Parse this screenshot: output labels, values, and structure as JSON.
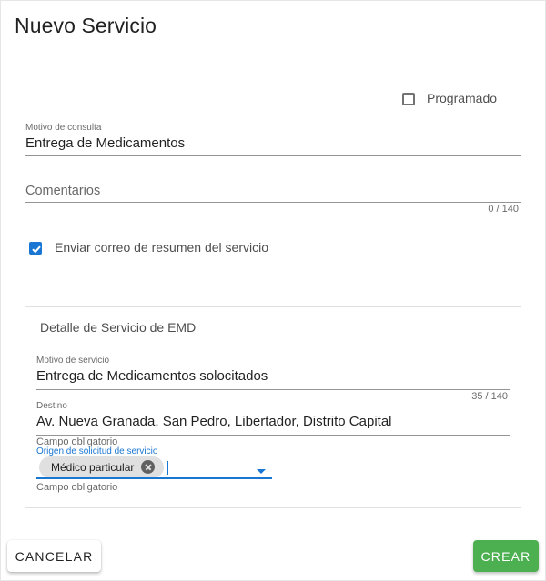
{
  "dialog": {
    "title": "Nuevo Servicio"
  },
  "programado": {
    "label": "Programado",
    "checked": false
  },
  "motivo_consulta": {
    "label": "Motivo de consulta",
    "value": "Entrega de Medicamentos"
  },
  "comentarios": {
    "placeholder": "Comentarios",
    "counter": "0 / 140"
  },
  "enviar_correo": {
    "label": "Enviar correo de resumen del servicio",
    "checked": true
  },
  "emd": {
    "section_title": "Detalle de Servicio de EMD",
    "motivo_servicio": {
      "label": "Motivo de servicio",
      "value": "Entrega de Medicamentos solocitados",
      "counter": "35 / 140"
    },
    "destino": {
      "label": "Destino",
      "value": "Av. Nueva Granada, San Pedro, Libertador, Distrito Capital",
      "hint": "Campo obligatorio"
    },
    "origen": {
      "label": "Origen de solicitud de servicio",
      "chip": "Médico particular",
      "hint": "Campo obligatorio"
    }
  },
  "actions": {
    "cancel_label": "Cancelar",
    "create_label": "Crear"
  },
  "colors": {
    "accent": "#1976d2",
    "create_button": "#4caf50"
  }
}
